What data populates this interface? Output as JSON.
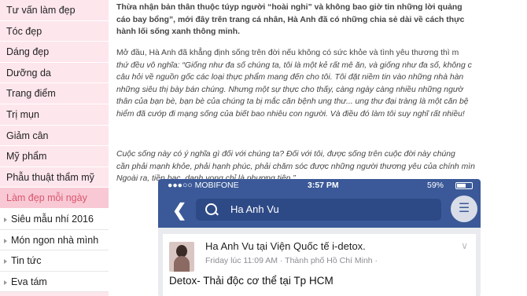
{
  "sidebar": {
    "items": [
      {
        "label": "Tư vấn làm đẹp"
      },
      {
        "label": "Tóc đẹp"
      },
      {
        "label": "Dáng đẹp"
      },
      {
        "label": "Dưỡng da"
      },
      {
        "label": "Trang điểm"
      },
      {
        "label": "Trị mụn"
      },
      {
        "label": "Giảm cân"
      },
      {
        "label": "Mỹ phẩm"
      },
      {
        "label": "Phẫu thuật thẩm mỹ"
      },
      {
        "label": "Làm đẹp mỗi ngày"
      },
      {
        "label": "Siêu mẫu nhí 2016"
      },
      {
        "label": "Món ngon nhà mình"
      },
      {
        "label": "Tin tức"
      },
      {
        "label": "Eva tám"
      }
    ]
  },
  "article": {
    "intro": [
      "Thừa nhận bản thân thuộc túyp người “hoài nghi” và không bao giờ tin những lời quảng",
      "cáo bay bổng”, mới đây trên trang cá nhân, Hà Anh đã có những chia sẻ dài về cách thực",
      "hành lối sống xanh thông minh."
    ],
    "para2": [
      "Mở đầu, Hà Anh đã khẳng định sống trên đời nếu không có sức khỏe và tình yêu thương thì m",
      "thứ đều vô nghĩa: “Giống như đa số chúng ta, tôi là một kẻ rất mê ăn, và giống như đa số, không c",
      "câu hỏi về nguồn gốc các loại thực phẩm mang đến cho tôi. Tôi đặt niềm tin vào những nhà hàn",
      "những siêu thị bày bán chúng. Nhưng một sự thực cho thấy, càng ngày càng nhiều những ngườ",
      "thân của bạn bè, bạn bè của chúng ta bị mắc căn bệnh ung thư... ung thư đại tràng là một căn bệ",
      "hiểm đã cướp đi mạng sống của biết bao nhiêu con người. Và điều đó làm tôi suy nghĩ rất nhiều!"
    ],
    "para3": [
      "Cuộc sống này có ý nghĩa gì đối với chúng ta? Đối với tôi, được sống trên cuộc đời này chúng",
      "cần phải mạnh khỏe, phải hạnh phúc, phải chăm sóc được những người thương yêu của chính mìn",
      "Ngoài ra, tiền bạc, danh vọng chỉ là phương tiện.”"
    ]
  },
  "phone": {
    "carrier": "●●●○○ MOBIFONE",
    "time": "3:57 PM",
    "battery": "59%",
    "search_query": "Ha Anh Vu",
    "post": {
      "author": "Ha Anh Vu tại  Viện Quốc tế i-detox.",
      "meta": "Friday lúc 11:09 AM · Thành phố Hồ Chí Minh ·",
      "body": "Detox- Thải độc cơ thể tại Tp HCM"
    }
  },
  "colors": {
    "sidebar_bg": "#fde6ec",
    "active_bg": "#f8c9d4",
    "active_text": "#d9566f",
    "facebook_blue": "#3b5998"
  }
}
